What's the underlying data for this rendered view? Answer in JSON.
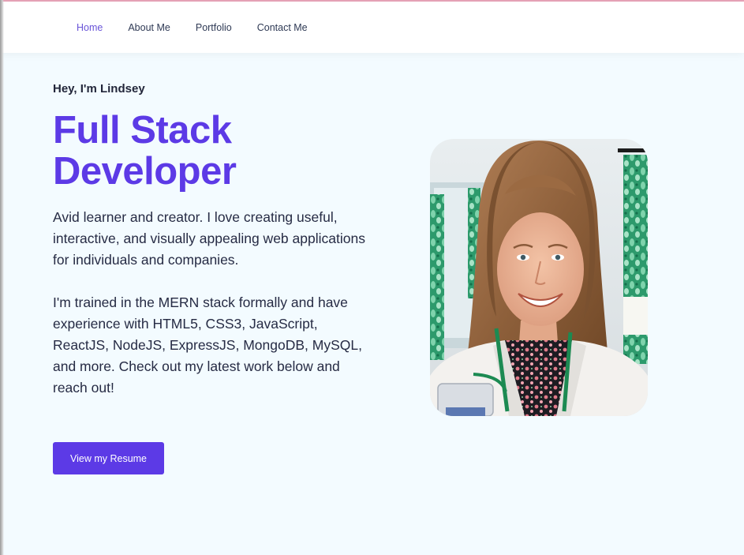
{
  "nav": {
    "items": [
      {
        "label": "Home",
        "active": true
      },
      {
        "label": "About Me",
        "active": false
      },
      {
        "label": "Portfolio",
        "active": false
      },
      {
        "label": "Contact Me",
        "active": false
      }
    ]
  },
  "hero": {
    "greeting": "Hey, I'm Lindsey",
    "title_line1": "Full Stack",
    "title_line2": "Developer",
    "paragraph1": "Avid learner and creator. I love creating useful, interactive, and visually appealing web applications for individuals and companies.",
    "paragraph2": "I'm trained in the MERN stack formally and have experience with HTML5, CSS3, JavaScript, ReactJS, NodeJS, ExpressJS, MongoDB, MySQL, and more. Check out my latest work below and reach out!",
    "button_label": "View my Resume"
  },
  "colors": {
    "accent": "#5c3ae6",
    "background": "#f3fbff",
    "text": "#262b44",
    "nav_active": "#6a55d8"
  }
}
